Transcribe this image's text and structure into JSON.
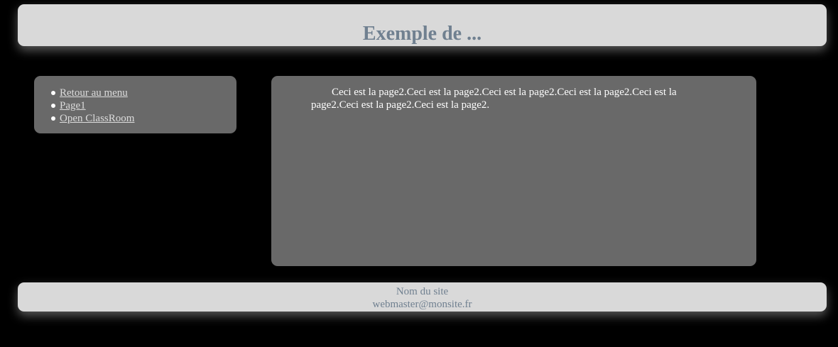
{
  "header": {
    "title": "Exemple de ..."
  },
  "nav": {
    "items": [
      {
        "label": "Retour au menu"
      },
      {
        "label": "Page1"
      },
      {
        "label": "Open ClassRoom"
      }
    ]
  },
  "content": {
    "text": "Ceci est la page2.Ceci est la page2.Ceci est la page2.Ceci est la page2.Ceci est la page2.Ceci est la page2.Ceci est la page2."
  },
  "footer": {
    "site_name": "Nom du site",
    "email": "webmaster@monsite.fr"
  },
  "colors": {
    "page_background": "#000000",
    "header_footer_background": "#d9d9d9",
    "panel_background": "#696969",
    "title_color": "#708090",
    "link_color": "#dcdcdc"
  }
}
